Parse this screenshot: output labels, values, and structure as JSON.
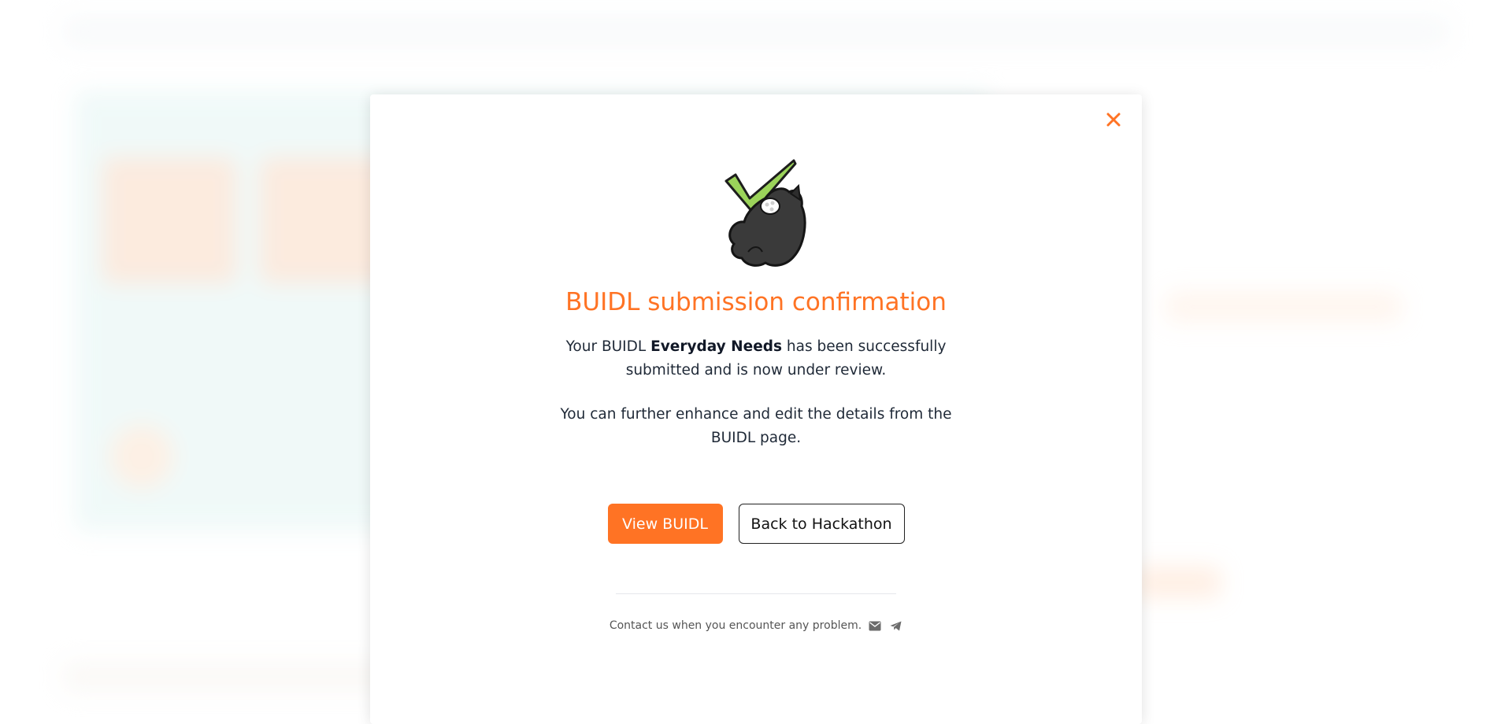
{
  "modal": {
    "title": "BUIDL submission confirmation",
    "message_prefix": "Your BUIDL ",
    "buidl_name": "Everyday Needs",
    "message_suffix": " has been successfully submitted and is now under review.",
    "message_2": "You can further enhance and edit the details from the BUIDL page.",
    "primary_button": "View BUIDL",
    "secondary_button": "Back to Hackathon",
    "contact_text": "Contact us when you encounter any problem.",
    "icons": [
      "close-icon",
      "success-checkmark-illustration",
      "mail-icon",
      "telegram-icon"
    ]
  },
  "colors": {
    "accent": "#ff7324",
    "check_green": "#9bd35a",
    "text": "#1f2937"
  }
}
